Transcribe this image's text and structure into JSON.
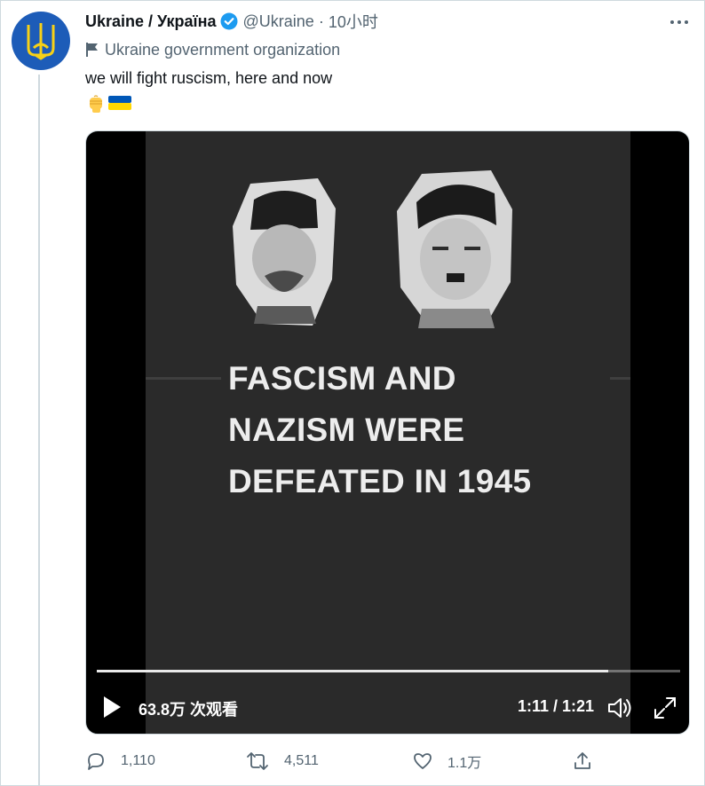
{
  "tweet": {
    "author_name": "Ukraine / Україна",
    "handle": "@Ukraine",
    "separator": "·",
    "time": "10小时",
    "affiliation": "Ukraine government organization",
    "text": "we will fight ruscism, here and now",
    "emojis": [
      "raised-fist",
      "ukraine-flag"
    ]
  },
  "video": {
    "caption_lines": [
      "FASCISM AND",
      "NAZISM WERE",
      "DEFEATED IN 1945"
    ],
    "views": "63.8万 次观看",
    "time_display": "1:11 / 1:21",
    "progress": 0.877
  },
  "actions": {
    "reply_count": "1,110",
    "retweet_count": "4,511",
    "like_count": "1.1万"
  },
  "colors": {
    "accent": "#1d9bf0",
    "secondary_text": "#536471",
    "flag_blue": "#0057b7",
    "flag_yellow": "#ffd700"
  }
}
